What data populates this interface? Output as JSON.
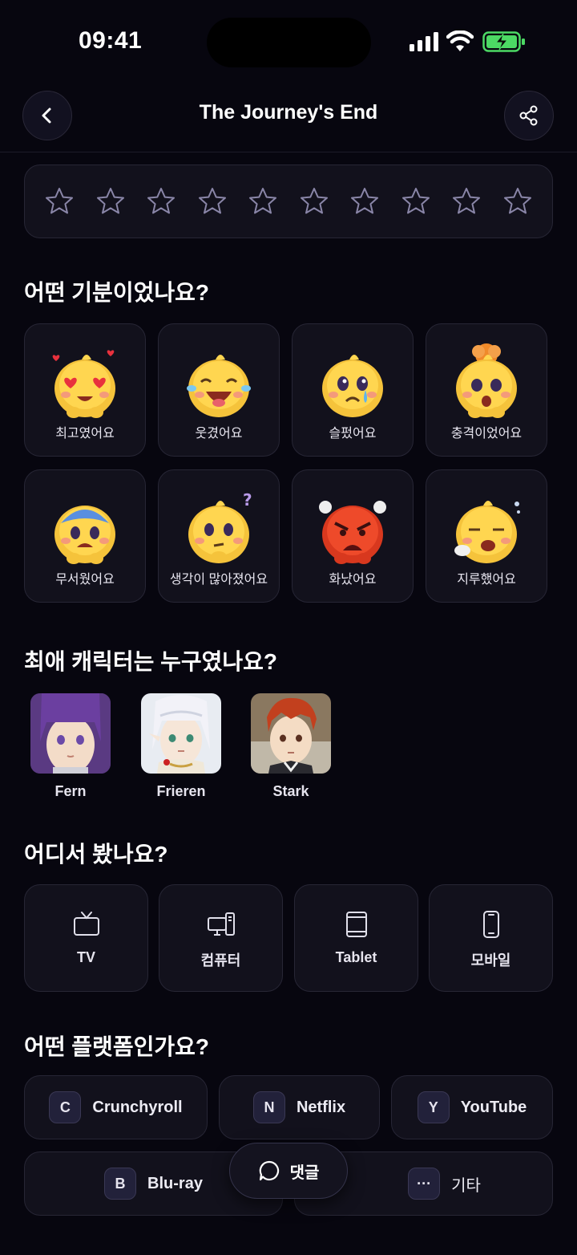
{
  "status": {
    "time": "09:41"
  },
  "nav": {
    "title": "The Journey's End"
  },
  "rating": {
    "max": 10,
    "value": 0
  },
  "sections": {
    "mood": "어떤 기분이었나요?",
    "character": "최애 캐릭터는 누구였나요?",
    "device": "어디서 봤나요?",
    "platform": "어떤 플랫폼인가요?"
  },
  "moods": [
    {
      "label": "최고였어요",
      "icon": "heart-eyes-emoji"
    },
    {
      "label": "웃겼어요",
      "icon": "laughing-emoji"
    },
    {
      "label": "슬펐어요",
      "icon": "sad-emoji"
    },
    {
      "label": "충격이었어요",
      "icon": "mind-blown-emoji"
    },
    {
      "label": "무서웠어요",
      "icon": "scared-emoji"
    },
    {
      "label": "생각이 많아졌어요",
      "icon": "thinking-emoji"
    },
    {
      "label": "화났어요",
      "icon": "angry-emoji"
    },
    {
      "label": "지루했어요",
      "icon": "bored-emoji"
    }
  ],
  "characters": [
    {
      "name": "Fern"
    },
    {
      "name": "Frieren"
    },
    {
      "name": "Stark"
    }
  ],
  "devices": [
    {
      "label": "TV",
      "icon": "tv-icon"
    },
    {
      "label": "컴퓨터",
      "icon": "computer-icon"
    },
    {
      "label": "Tablet",
      "icon": "tablet-icon"
    },
    {
      "label": "모바일",
      "icon": "mobile-icon"
    }
  ],
  "platforms": [
    {
      "badge": "C",
      "name": "Crunchyroll"
    },
    {
      "badge": "N",
      "name": "Netflix"
    },
    {
      "badge": "Y",
      "name": "YouTube"
    },
    {
      "badge": "B",
      "name": "Blu-ray"
    },
    {
      "badge": "···",
      "name": "기타"
    }
  ],
  "comment": {
    "label": "댓글"
  },
  "colors": {
    "background": "#07060f",
    "card": "#12111c",
    "star_outline": "#8a86a8",
    "battery": "#4cd964"
  }
}
